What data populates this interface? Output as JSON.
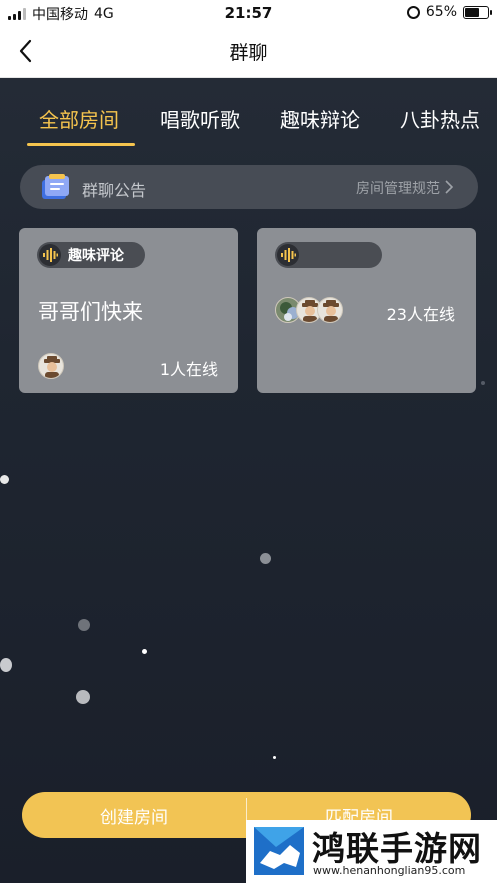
{
  "status_bar": {
    "carrier": "中国移动",
    "network": "4G",
    "time": "21:57",
    "battery": "65%",
    "battery_level": 0.65
  },
  "nav": {
    "title": "群聊"
  },
  "tabs": [
    {
      "label": "全部房间",
      "active": true
    },
    {
      "label": "唱歌听歌",
      "active": false
    },
    {
      "label": "趣味辩论",
      "active": false
    },
    {
      "label": "八卦热点",
      "active": false
    }
  ],
  "notice": {
    "title": "群聊公告",
    "link": "房间管理规范"
  },
  "rooms": [
    {
      "tag": "趣味评论",
      "title": "哥哥们快来",
      "online": "1人在线"
    },
    {
      "tag": "",
      "title": "",
      "online": "23人在线"
    }
  ],
  "actions": {
    "create": "创建房间",
    "match": "匹配房间"
  },
  "watermark": {
    "title": "鸿联手游网",
    "url": "www.henanhonglian95.com"
  },
  "colors": {
    "accent": "#f5c44e",
    "background": "#1b2029",
    "card": "#8c8f94",
    "button": "#f2c454"
  },
  "icons": {
    "back": "chevron-left-icon",
    "notice": "clipboard-icon",
    "tag": "sound-wave-icon",
    "alarm": "alarm-icon",
    "signal": "signal-icon"
  }
}
